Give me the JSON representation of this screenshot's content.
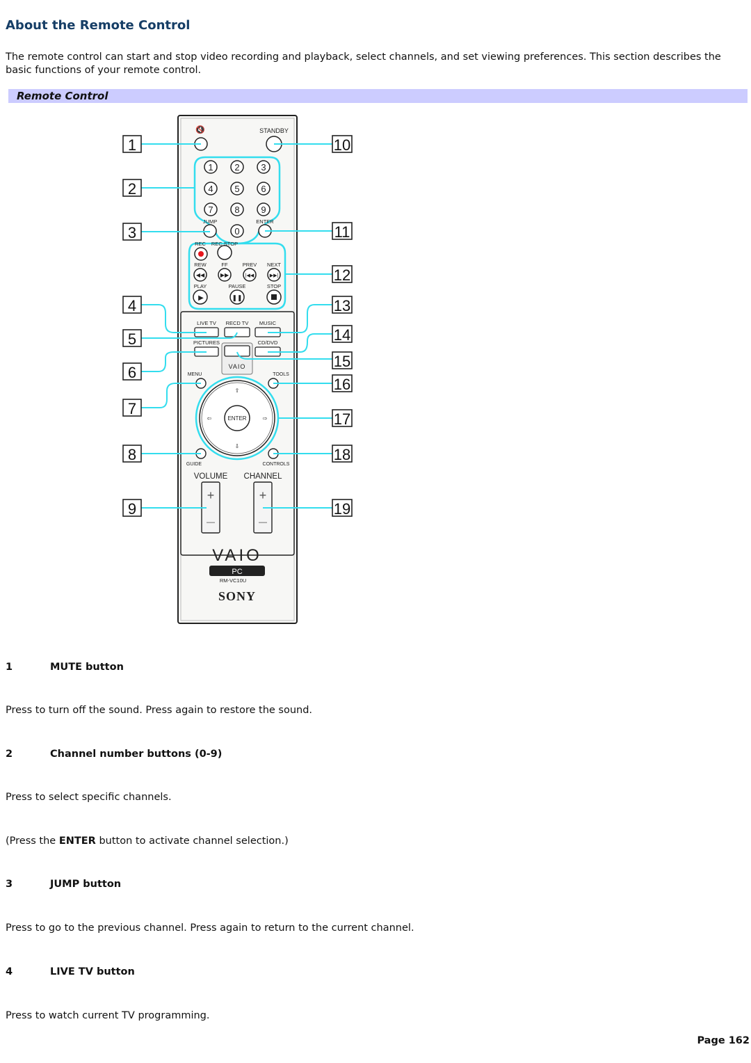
{
  "page": {
    "title": "About the Remote Control",
    "intro": "The remote control can start and stop video recording and playback, select channels, and set viewing preferences. This section describes the basic functions of your remote control.",
    "figure_caption": "Remote Control",
    "page_label": "Page 162"
  },
  "figure": {
    "callout_color": "#33ddee",
    "rec_color": "#e8161c",
    "labels": {
      "mute_icon": "🔇",
      "standby": "STANDBY",
      "digits": [
        "1",
        "2",
        "3",
        "4",
        "5",
        "6",
        "7",
        "8",
        "9",
        "0"
      ],
      "jump": "JUMP",
      "enter_small": "ENTER",
      "rec": "REC",
      "rec_stop": "REC STOP",
      "rew": "REW",
      "ff": "FF",
      "prev": "PREV",
      "next": "NEXT",
      "play": "PLAY",
      "pause": "PAUSE",
      "stop": "STOP",
      "live_tv": "LIVE TV",
      "recd_tv": "RECD TV",
      "music": "MUSIC",
      "pictures": "PICTURES",
      "cd_dvd": "CD/DVD",
      "vaio_small": "VAIO",
      "menu": "MENU",
      "tools": "TOOLS",
      "enter": "ENTER",
      "guide": "GUIDE",
      "controls": "CONTROLS",
      "volume": "VOLUME",
      "channel": "CHANNEL",
      "plus": "+",
      "minus": "—",
      "vaio_logo": "VAIO",
      "pc": "PC",
      "model": "RM-VC10U",
      "sony": "SONY"
    },
    "callouts_left": [
      "1",
      "2",
      "3",
      "4",
      "5",
      "6",
      "7",
      "8",
      "9"
    ],
    "callouts_right": [
      "10",
      "11",
      "12",
      "13",
      "14",
      "15",
      "16",
      "17",
      "18",
      "19"
    ]
  },
  "items": [
    {
      "number": "1",
      "title": "MUTE button",
      "paragraphs": [
        "Press to turn off the sound. Press again to restore the sound."
      ]
    },
    {
      "number": "2",
      "title": "Channel number buttons (0-9)",
      "paragraphs": [
        "Press to select specific channels."
      ],
      "note_prefix": "(Press the ",
      "note_bold": "ENTER",
      "note_suffix": " button to activate channel selection.)"
    },
    {
      "number": "3",
      "title": "JUMP button",
      "paragraphs": [
        "Press to go to the previous channel. Press again to return to the current channel."
      ]
    },
    {
      "number": "4",
      "title": "LIVE TV button",
      "paragraphs": [
        "Press to watch current TV programming."
      ]
    }
  ]
}
